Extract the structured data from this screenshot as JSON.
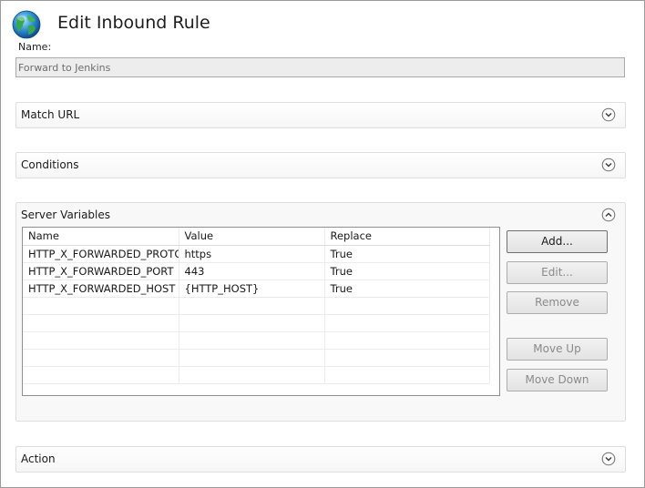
{
  "dialog": {
    "title": "Edit Inbound Rule",
    "icon": "globe-icon"
  },
  "name_field": {
    "label": "Name:",
    "value": "Forward to Jenkins"
  },
  "sections": {
    "match_url": {
      "title": "Match URL",
      "state": "collapsed"
    },
    "conditions": {
      "title": "Conditions",
      "state": "collapsed"
    },
    "server_variables": {
      "title": "Server Variables",
      "state": "expanded"
    },
    "action": {
      "title": "Action",
      "state": "collapsed"
    }
  },
  "server_variables": {
    "columns": [
      "Name",
      "Value",
      "Replace"
    ],
    "rows": [
      {
        "name": "HTTP_X_FORWARDED_PROTO",
        "value": "https",
        "replace": "True"
      },
      {
        "name": "HTTP_X_FORWARDED_PORT",
        "value": "443",
        "replace": "True"
      },
      {
        "name": "HTTP_X_FORWARDED_HOST",
        "value": "{HTTP_HOST}",
        "replace": "True"
      }
    ],
    "buttons": {
      "add": "Add...",
      "edit": "Edit...",
      "remove": "Remove",
      "move_up": "Move Up",
      "move_down": "Move Down"
    }
  },
  "colors": {
    "accent": "#1e1e1e",
    "disabled_text": "#8a8a8a"
  }
}
